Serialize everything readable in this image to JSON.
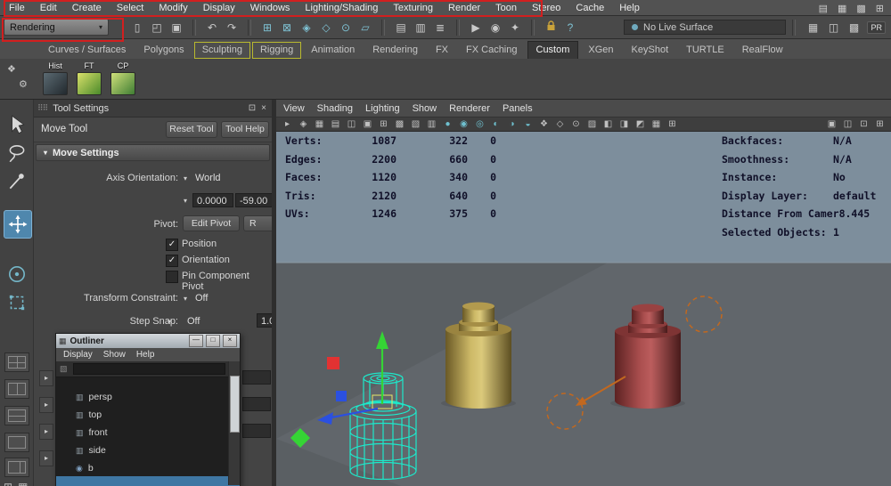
{
  "menubar": {
    "items": [
      "File",
      "Edit",
      "Create",
      "Select",
      "Modify",
      "Display",
      "Windows",
      "Lighting/Shading",
      "Texturing",
      "Render",
      "Toon",
      "Stereo",
      "Cache",
      "Help"
    ],
    "right_icons": [
      "▤",
      "▦",
      "▩",
      "⊞"
    ]
  },
  "statusline": {
    "menuset": "Rendering",
    "live_surface_label": "No Live Surface",
    "pr_badge": "PR",
    "icons": [
      "▯",
      "◰",
      "▣",
      "↶",
      "↷",
      "⊞",
      "⊠",
      "◈",
      "◇",
      "⊙",
      "▱",
      "▤",
      "▥",
      "≣",
      "▶",
      "◉",
      "✦",
      "?"
    ],
    "right_icons": [
      "▦",
      "◫",
      "▩"
    ]
  },
  "shelf": {
    "tabs": [
      "Curves / Surfaces",
      "Polygons",
      "Sculpting",
      "Rigging",
      "Animation",
      "Rendering",
      "FX",
      "FX Caching",
      "Custom",
      "XGen",
      "KeyShot",
      "TURTLE",
      "RealFlow"
    ],
    "active_tab": "Custom",
    "items": [
      "Hist",
      "FT",
      "CP"
    ]
  },
  "tool_settings": {
    "title": "Tool Settings",
    "tool_name": "Move Tool",
    "reset_button": "Reset Tool",
    "help_button": "Tool Help",
    "section_title": "Move Settings",
    "axis_orientation_label": "Axis Orientation:",
    "axis_orientation_value": "World",
    "field_x": "0.0000",
    "field_y": "-59.00",
    "pivot_label": "Pivot:",
    "edit_pivot_button": "Edit Pivot",
    "reset_pivot_button": "R",
    "checkbox_position": "Position",
    "checkbox_orientation": "Orientation",
    "checkbox_pin": "Pin Component Pivot",
    "transform_constraint_label": "Transform Constraint:",
    "transform_constraint_value": "Off",
    "step_snap_label": "Step Snap:",
    "step_snap_value": "Off",
    "step_snap_size": "1.0"
  },
  "outliner": {
    "title": "Outliner",
    "menus": [
      "Display",
      "Show",
      "Help"
    ],
    "items": [
      "persp",
      "top",
      "front",
      "side",
      "b"
    ]
  },
  "viewport": {
    "menus": [
      "View",
      "Shading",
      "Lighting",
      "Show",
      "Renderer",
      "Panels"
    ],
    "toolbar_icons": [
      "▸",
      "◈",
      "▦",
      "▤",
      "◫",
      "▣",
      "⊞",
      "▩",
      "▧",
      "▥",
      "●",
      "◉",
      "◎",
      "◐",
      "◑",
      "◒",
      "❖",
      "◇",
      "⊙",
      "▨",
      "◧",
      "◨",
      "◩",
      "▦",
      "⊞",
      "▣",
      "◫",
      "⊡",
      "⊞"
    ],
    "hud_left": {
      "rows": [
        {
          "label": "Verts:",
          "c1": "1087",
          "c2": "322",
          "c3": "0"
        },
        {
          "label": "Edges:",
          "c1": "2200",
          "c2": "660",
          "c3": "0"
        },
        {
          "label": "Faces:",
          "c1": "1120",
          "c2": "340",
          "c3": "0"
        },
        {
          "label": "Tris:",
          "c1": "2120",
          "c2": "640",
          "c3": "0"
        },
        {
          "label": "UVs:",
          "c1": "1246",
          "c2": "375",
          "c3": "0"
        }
      ]
    },
    "hud_right": {
      "rows": [
        {
          "label": "Backfaces:",
          "value": "N/A"
        },
        {
          "label": "Smoothness:",
          "value": "N/A"
        },
        {
          "label": "Instance:",
          "value": "No"
        },
        {
          "label": "Display Layer:",
          "value": "default"
        },
        {
          "label": "Distance From Camer",
          "value": "8.445"
        },
        {
          "label": "Selected Objects:",
          "value": "1"
        }
      ]
    }
  },
  "ui": {
    "caret_down": "▾",
    "caret_right": "▸",
    "check": "✓",
    "drag_handle": "⠿⠿",
    "float_icon": "⊡",
    "close_icon": "×",
    "min_icon": "—",
    "max_icon": "□",
    "window_icon": "▦",
    "camera_icon": "▥",
    "material_icon": "◉",
    "filter_icon": "▧",
    "gear_icon": "⚙",
    "menu_grid_icon": "❖",
    "corner_icon_1": "⊞",
    "corner_icon_2": "▦"
  },
  "colors": {
    "annotation_red": "#d21f1f",
    "tab_highlight_yellow": "#b9b92e",
    "viewport_sky": "#7d8e9c",
    "viewport_ground": "#5a5f63",
    "selection_wire_cyan": "#1de9cb",
    "manipulator_green": "#35d435",
    "manipulator_blue": "#2b50e0",
    "manipulator_red": "#e23232",
    "rotate_ring_orange": "#c2681f",
    "hud_text": "#101028",
    "move_tool_active_bg": "#4f87ad"
  }
}
